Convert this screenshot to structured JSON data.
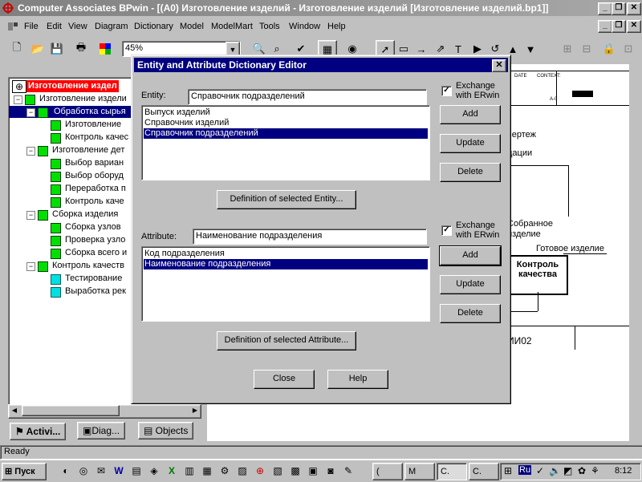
{
  "window": {
    "title": "Computer Associates BPwin - [(A0) Изготовление изделий - Изготовление изделий  [Изготовление изделий.bp1]]",
    "controls": {
      "minimize": "_",
      "restore": "❐",
      "close": "✕"
    }
  },
  "menu": {
    "items": [
      "File",
      "Edit",
      "View",
      "Diagram",
      "Dictionary",
      "Model",
      "ModelMart",
      "Tools",
      "Window",
      "Help"
    ],
    "doc_controls": {
      "minimize": "_",
      "restore": "❐",
      "close": "✕"
    }
  },
  "toolbar": {
    "zoom_value": "45%"
  },
  "tree": {
    "nodes": [
      {
        "label": "Изготовление издел",
        "level": 0,
        "root": true
      },
      {
        "label": "Изготовление издели",
        "level": 1
      },
      {
        "label": "Обработка сырья",
        "level": 2,
        "selected": true
      },
      {
        "label": "Изготовление",
        "level": 3
      },
      {
        "label": "Контроль качес",
        "level": 3
      },
      {
        "label": "Изготовление дет",
        "level": 2
      },
      {
        "label": "Выбор вариан",
        "level": 3
      },
      {
        "label": "Выбор оборуд",
        "level": 3
      },
      {
        "label": "Переработка п",
        "level": 3
      },
      {
        "label": "Контроль каче",
        "level": 3
      },
      {
        "label": "Сборка изделия",
        "level": 2
      },
      {
        "label": "Сборка узлов",
        "level": 3
      },
      {
        "label": "Проверка узло",
        "level": 3
      },
      {
        "label": "Сборка всего и",
        "level": 3
      },
      {
        "label": "Контроль качеств",
        "level": 2
      },
      {
        "label": "Тестирование",
        "level": 3,
        "cyan": true
      },
      {
        "label": "Выработка рек",
        "level": 3,
        "cyan": true
      }
    ],
    "tabs": [
      "Activi...",
      "Diag...",
      "Objects"
    ]
  },
  "canvas": {
    "header_date": "DATE",
    "header_context": "CONTEXT:",
    "header_node": "A-0",
    "texts": [
      "чертеж",
      "дации",
      "Собранное",
      "изделие",
      "Готовое изделие",
      "Контроль",
      "качества",
      "ИИ02"
    ]
  },
  "dialog": {
    "title": "Entity and Attribute Dictionary Editor",
    "entity_label": "Entity:",
    "entity_value": "Справочник подразделений",
    "entity_exchange": "Exchange with ERwin",
    "entity_list": [
      "Выпуск изделий",
      "Справочник изделий",
      "Справочник подразделений"
    ],
    "entity_selected_index": 2,
    "entity_buttons": {
      "add": "Add",
      "update": "Update",
      "delete": "Delete"
    },
    "def_entity_button": "Definition of selected Entity...",
    "attribute_label": "Attribute:",
    "attribute_value": "Наименование подразделения",
    "attribute_exchange": "Exchange with ERwin",
    "attribute_list": [
      "Код подразделения",
      "Наименование подразделения"
    ],
    "attribute_selected_index": 1,
    "attribute_buttons": {
      "add": "Add",
      "update": "Update",
      "delete": "Delete"
    },
    "def_attribute_button": "Definition of selected Attribute...",
    "close_button": "Close",
    "help_button": "Help"
  },
  "status": {
    "text": "Ready"
  },
  "taskbar": {
    "start_label": "Пуск",
    "tasks": [
      "(",
      "M",
      "C.",
      "C."
    ],
    "tray_lang": "Ru",
    "clock": "8:12"
  }
}
